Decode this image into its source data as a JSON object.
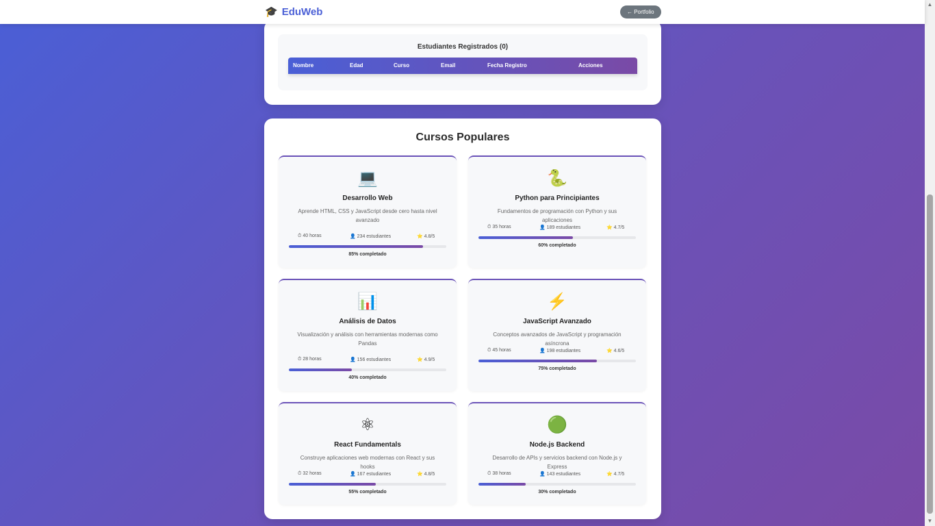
{
  "header": {
    "brand_icon": "🎓",
    "brand": "EduWeb",
    "portfolio_label": "← Portfolio"
  },
  "students": {
    "title": "Estudiantes Registrados (0)",
    "columns": [
      "Nombre",
      "Edad",
      "Curso",
      "Email",
      "Fecha Registro",
      "Acciones"
    ]
  },
  "courses": {
    "title": "Cursos Populares",
    "items": [
      {
        "icon": "💻",
        "title": "Desarrollo Web",
        "desc": "Aprende HTML, CSS y JavaScript desde cero hasta nivel avanzado",
        "hours": "⏱ 40 horas",
        "students": "👤 234 estudiantes",
        "rating": "⭐ 4.8/5",
        "progress": 85,
        "progress_text": "85% completado"
      },
      {
        "icon": "🐍",
        "title": "Python para Principiantes",
        "desc": "Fundamentos de programación con Python y sus aplicaciones",
        "hours": "⏱ 35 horas",
        "students": "👤 189 estudiantes",
        "rating": "⭐ 4.7/5",
        "progress": 60,
        "progress_text": "60% completado"
      },
      {
        "icon": "📊",
        "title": "Análisis de Datos",
        "desc": "Visualización y análisis con herramientas modernas como Pandas",
        "hours": "⏱ 28 horas",
        "students": "👤 156 estudiantes",
        "rating": "⭐ 4.9/5",
        "progress": 40,
        "progress_text": "40% completado"
      },
      {
        "icon": "⚡",
        "title": "JavaScript Avanzado",
        "desc": "Conceptos avanzados de JavaScript y programación asíncrona",
        "hours": "⏱ 45 horas",
        "students": "👤 198 estudiantes",
        "rating": "⭐ 4.6/5",
        "progress": 75,
        "progress_text": "75% completado"
      },
      {
        "icon": "⚛",
        "title": "React Fundamentals",
        "desc": "Construye aplicaciones web modernas con React y sus hooks",
        "hours": "⏱ 32 horas",
        "students": "👤 167 estudiantes",
        "rating": "⭐ 4.8/5",
        "progress": 55,
        "progress_text": "55% completado"
      },
      {
        "icon": "🟢",
        "title": "Node.js Backend",
        "desc": "Desarrollo de APIs y servicios backend con Node.js y Express",
        "hours": "⏱ 38 horas",
        "students": "👤 143 estudiantes",
        "rating": "⭐ 4.7/5",
        "progress": 30,
        "progress_text": "30% completado"
      }
    ]
  }
}
